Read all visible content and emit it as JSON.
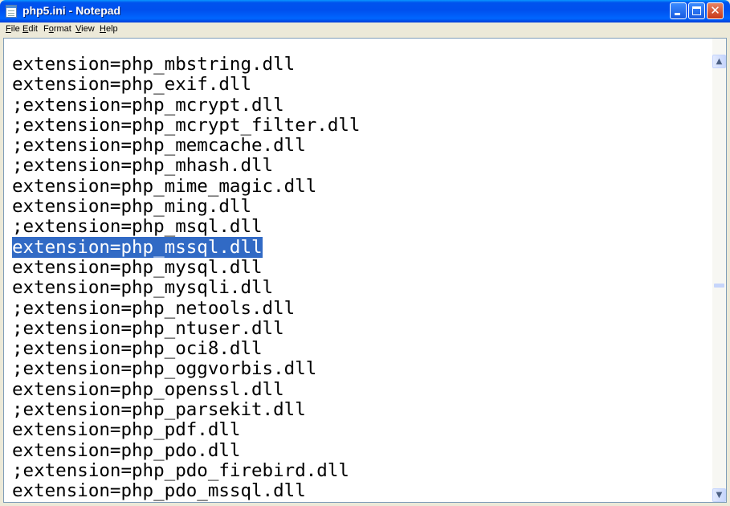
{
  "window": {
    "title": "php5.ini - Notepad",
    "close_glyph": "✕"
  },
  "menu": {
    "file": {
      "u": "F",
      "rest": "ile"
    },
    "edit": {
      "u": "E",
      "rest": "dit"
    },
    "format": {
      "pre": "F",
      "u": "o",
      "rest": "rmat"
    },
    "view": {
      "u": "V",
      "rest": "iew"
    },
    "help": {
      "u": "H",
      "rest": "elp"
    }
  },
  "editor": {
    "lines": [
      "extension=php_mbstring.dll",
      "extension=php_exif.dll",
      ";extension=php_mcrypt.dll",
      ";extension=php_mcrypt_filter.dll",
      ";extension=php_memcache.dll",
      ";extension=php_mhash.dll",
      "extension=php_mime_magic.dll",
      "extension=php_ming.dll",
      ";extension=php_msql.dll",
      "extension=php_mssql.dll",
      "extension=php_mysql.dll",
      "extension=php_mysqli.dll",
      ";extension=php_netools.dll",
      ";extension=php_ntuser.dll",
      ";extension=php_oci8.dll",
      ";extension=php_oggvorbis.dll",
      "extension=php_openssl.dll",
      ";extension=php_parsekit.dll",
      "extension=php_pdf.dll",
      "extension=php_pdo.dll",
      ";extension=php_pdo_firebird.dll",
      "extension=php_pdo_mssql.dll"
    ],
    "selected_line": 9
  },
  "scrollbar": {
    "up_glyph": "▲",
    "down_glyph": "▼"
  }
}
